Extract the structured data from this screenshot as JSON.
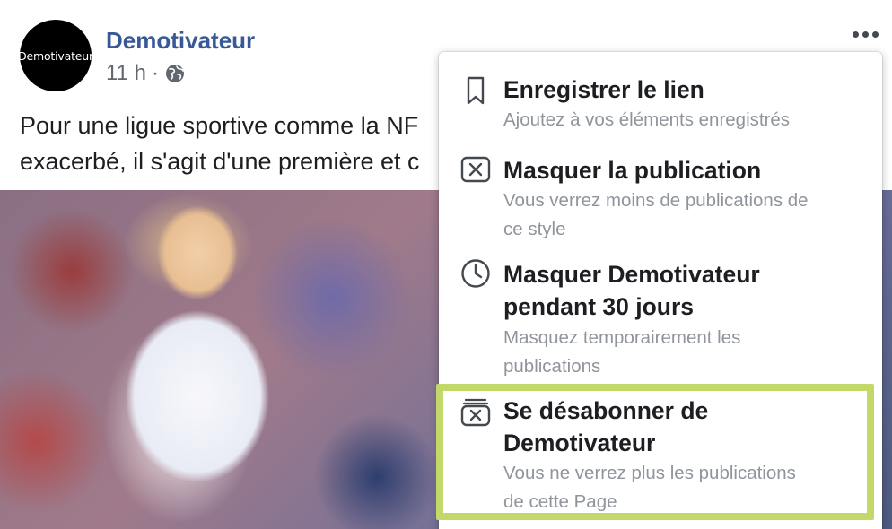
{
  "post": {
    "avatar_text": "Demotivateur",
    "page_name": "Demotivateur",
    "time": "11 h",
    "separator": "·",
    "audience_icon": "globe-icon",
    "text_line1": "Pour une ligue sportive comme la NF",
    "text_line2": "exacerbé, il s'agit d'une première et c"
  },
  "menu": {
    "items": [
      {
        "icon": "bookmark-icon",
        "title": "Enregistrer le lien",
        "subtitle": "Ajoutez à vos éléments enregistrés"
      },
      {
        "icon": "hide-post-icon",
        "title": "Masquer la publication",
        "subtitle_line1": "Vous verrez moins de publications de",
        "subtitle_line2": "ce style"
      },
      {
        "icon": "clock-icon",
        "title_line1": "Masquer Demotivateur",
        "title_line2": "pendant 30 jours",
        "subtitle_line1": "Masquez temporairement les",
        "subtitle_line2": "publications"
      },
      {
        "icon": "unfollow-icon",
        "title_line1": "Se désabonner de",
        "title_line2": "Demotivateur",
        "subtitle_line1": "Vous ne verrez plus les publications",
        "subtitle_line2": "de cette Page"
      }
    ]
  },
  "colors": {
    "link_blue": "#385898",
    "secondary_text": "#606770",
    "menu_subtitle": "#90949c",
    "highlight_border": "#c2d96a"
  }
}
